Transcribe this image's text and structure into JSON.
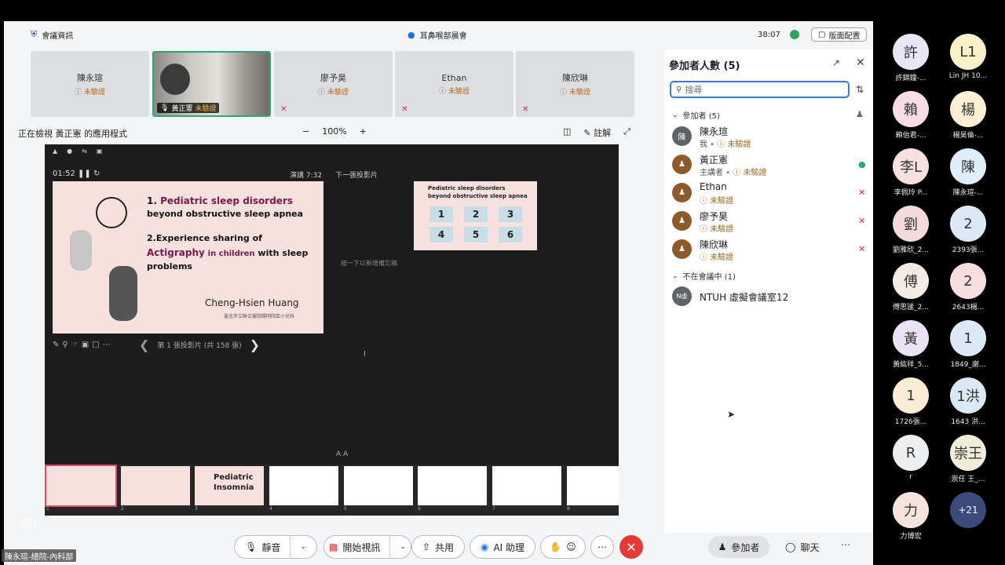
{
  "topbar": {
    "meeting_info": "會議資訊",
    "meeting_title": "耳鼻喉部晨會",
    "timer": "38:07",
    "layout_label": "版面配置"
  },
  "strip": {
    "tiles": [
      {
        "name": "陳永瑄",
        "status": "未驗證"
      },
      {
        "name": "黃正憲",
        "status": "未驗證"
      },
      {
        "name": "廖予昊",
        "status": "未驗證"
      },
      {
        "name": "Ethan",
        "status": "未驗證"
      },
      {
        "name": "陳欣琳",
        "status": "未驗證"
      }
    ]
  },
  "sharebar": {
    "viewing_text": "正在檢視 黃正憲 的應用程式",
    "zoom_minus": "−",
    "zoom": "100%",
    "zoom_plus": "+",
    "annotate": "註解"
  },
  "presenter": {
    "timer": "01:52",
    "elapsed": "演講 7:32",
    "next_label": "下一張投影片",
    "notes_placeholder": "按一下以新增備忘稿",
    "aa": "A A",
    "nav_text": "第 1 張投影片 (共 158 張)",
    "slide": {
      "l1_num": "1.",
      "l1_mag": "Pediatric sleep disorders",
      "l2": "beyond obstructive sleep apnea",
      "l3": "2.Experience sharing of",
      "l4_mag1": "Actigraphy",
      "l4_mag2": "in children",
      "l4_rest": "with sleep problems",
      "author": "Cheng-Hsien Huang",
      "affiliation": "臺北市立聯合醫院陽明院區小兒科"
    },
    "next_slide": {
      "title1": "Pediatric sleep disorders",
      "title2": "beyond obstructive sleep apnea",
      "cells": [
        "1",
        "2",
        "3",
        "4",
        "5",
        "6"
      ]
    },
    "thumbs": [
      {
        "n": "1"
      },
      {
        "n": "2"
      },
      {
        "n": "3",
        "text": "Pediatric Insomnia"
      },
      {
        "n": "4"
      },
      {
        "n": "5"
      },
      {
        "n": "6"
      },
      {
        "n": "7"
      },
      {
        "n": "8"
      }
    ]
  },
  "controls": {
    "mute": "靜音",
    "video": "開始視訊",
    "share": "共用",
    "ai": "AI 助理",
    "participants": "參加者",
    "chat": "聊天"
  },
  "caption_name": "陳永瑄-總院-內科部",
  "panel": {
    "title": "參加者人數 (5)",
    "search_placeholder": "搜尋",
    "section_in": "參加者 (5)",
    "section_out": "不在會議中 (1)",
    "people": [
      {
        "initial": "陳",
        "name": "陳永瑄",
        "role": "我",
        "status": "未驗證"
      },
      {
        "initial": "",
        "name": "黃正憲",
        "role": "主講者",
        "status": "未驗證"
      },
      {
        "initial": "",
        "name": "Ethan",
        "role": "",
        "status": "未驗證"
      },
      {
        "initial": "",
        "name": "廖予昊",
        "role": "",
        "status": "未驗證"
      },
      {
        "initial": "",
        "name": "陳欣琳",
        "role": "",
        "status": "未驗證"
      }
    ],
    "absent": [
      {
        "initial": "N虛",
        "name": "NTUH 虛擬會議室12"
      }
    ]
  },
  "gallery": [
    {
      "c": "許",
      "t": "許錦鐘-..."
    },
    {
      "c": "L1",
      "t": "Lin JH 10..."
    },
    {
      "c": "賴",
      "t": "賴佁君-..."
    },
    {
      "c": "楊",
      "t": "楊昊倫-..."
    },
    {
      "c": "李L",
      "t": "李佩玲 P..."
    },
    {
      "c": "陳",
      "t": "陳永瑄-..."
    },
    {
      "c": "劉",
      "t": "劉雅欣_2..."
    },
    {
      "c": "2",
      "t": "2393張..."
    },
    {
      "c": "傅",
      "t": "傅思謐_2..."
    },
    {
      "c": "2",
      "t": "2643楊..."
    },
    {
      "c": "黃",
      "t": "黃紘祥_5..."
    },
    {
      "c": "1",
      "t": "1849_謝..."
    },
    {
      "c": "1",
      "t": "1726張..."
    },
    {
      "c": "1洪",
      "t": "1643 洪..."
    },
    {
      "c": "R",
      "t": "r"
    },
    {
      "c": "崇王",
      "t": "崇任 王_..."
    },
    {
      "c": "力",
      "t": "力博宏"
    },
    {
      "c": "+21",
      "t": ""
    }
  ]
}
